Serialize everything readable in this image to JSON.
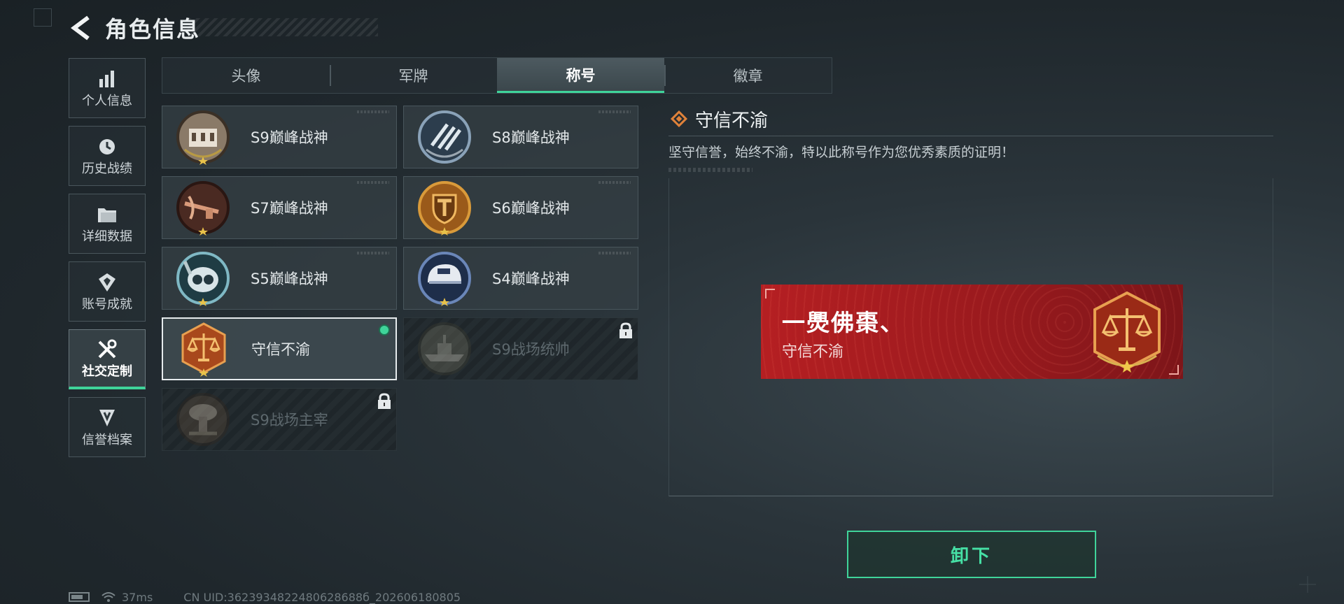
{
  "header": {
    "title": "角色信息"
  },
  "sidebar": {
    "items": [
      {
        "label": "个人信息",
        "icon": "bar-chart-icon"
      },
      {
        "label": "历史战绩",
        "icon": "history-clock-icon"
      },
      {
        "label": "详细数据",
        "icon": "folder-icon"
      },
      {
        "label": "账号成就",
        "icon": "achievement-icon"
      },
      {
        "label": "社交定制",
        "icon": "tools-icon",
        "active": true
      },
      {
        "label": "信誉档案",
        "icon": "reputation-icon"
      }
    ]
  },
  "tabs": [
    {
      "label": "头像"
    },
    {
      "label": "军牌"
    },
    {
      "label": "称号",
      "active": true
    },
    {
      "label": "徽章"
    }
  ],
  "titles": [
    {
      "name": "S9巅峰战神",
      "state": "unlocked"
    },
    {
      "name": "S8巅峰战神",
      "state": "unlocked"
    },
    {
      "name": "S7巅峰战神",
      "state": "unlocked"
    },
    {
      "name": "S6巅峰战神",
      "state": "unlocked"
    },
    {
      "name": "S5巅峰战神",
      "state": "unlocked"
    },
    {
      "name": "S4巅峰战神",
      "state": "unlocked"
    },
    {
      "name": "守信不渝",
      "state": "equipped"
    },
    {
      "name": "S9战场统帅",
      "state": "locked"
    },
    {
      "name": "S9战场主宰",
      "state": "locked"
    }
  ],
  "detail": {
    "title": "守信不渝",
    "description": "坚守信誉，始终不渝，特以此称号作为您优秀素质的证明！"
  },
  "nameplate": {
    "player_name": "一爂佛棗、",
    "title": "守信不渝",
    "color": "#b51f22"
  },
  "action": {
    "unequip_label": "卸下"
  },
  "status_bar": {
    "ping": "37ms",
    "uid": "CN UID:3623934822480628688б_202606180805"
  },
  "colors": {
    "accent": "#3fd49a",
    "background": "#1f272c"
  }
}
